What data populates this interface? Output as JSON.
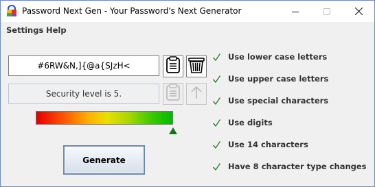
{
  "window": {
    "title": "Password Next Gen - Your Password's Next Generator"
  },
  "menu": {
    "items": [
      {
        "label": "Settings"
      },
      {
        "label": "Help"
      }
    ]
  },
  "generator": {
    "password": "#6RW&N,]{@a{SJzH<",
    "security_text": "Security level is 5.",
    "strength_level": 5,
    "generate_label": "Generate"
  },
  "rules": [
    {
      "label": "Use lower case letters",
      "checked": true
    },
    {
      "label": "Use upper case letters",
      "checked": true
    },
    {
      "label": "Use special characters",
      "checked": true
    },
    {
      "label": "Use digits",
      "checked": true
    },
    {
      "label": "Use 14 characters",
      "checked": true
    },
    {
      "label": "Have 8 character type changes",
      "checked": true
    }
  ],
  "colors": {
    "check": "#2f7d2f",
    "marker": "#0f7a1c",
    "button_border": "#6f87a6"
  },
  "icons": {
    "copy": "clipboard-icon",
    "trash": "trash-icon",
    "up": "arrow-up-icon"
  }
}
